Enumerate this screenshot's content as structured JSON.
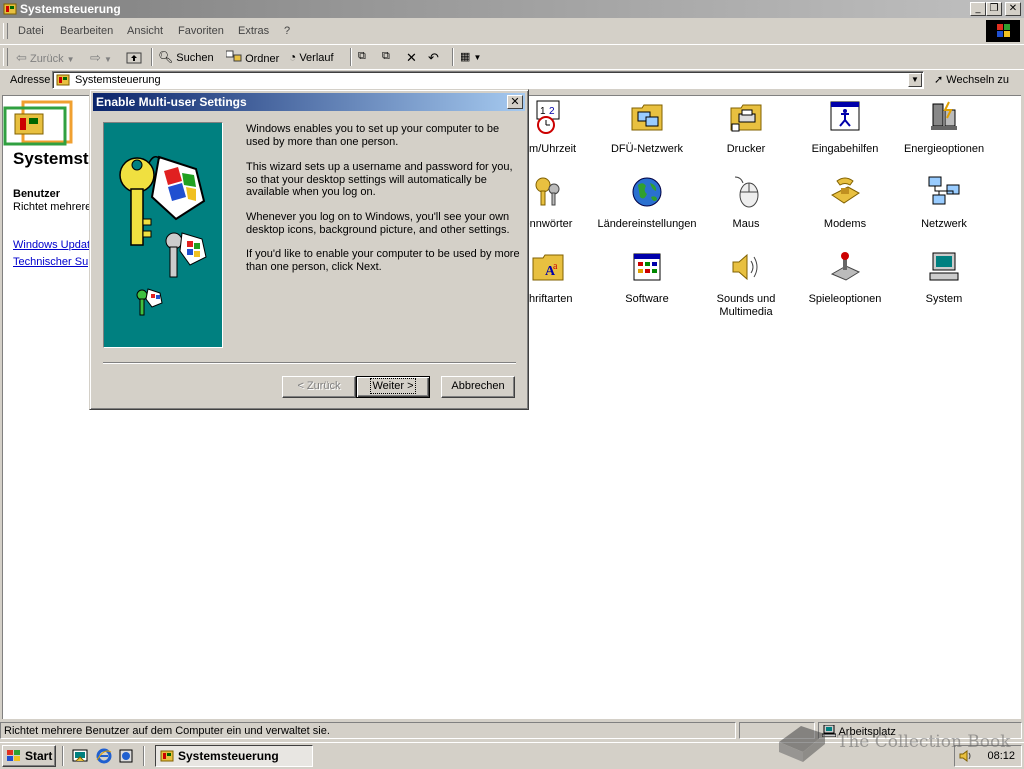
{
  "window": {
    "title": "Systemsteuerung"
  },
  "menu": [
    "Datei",
    "Bearbeiten",
    "Ansicht",
    "Favoriten",
    "Extras",
    "?"
  ],
  "toolbar": {
    "back": "Zurück",
    "search": "Suchen",
    "folders": "Ordner",
    "history": "Verlauf"
  },
  "address": {
    "label": "Adresse",
    "value": "Systemsteuerung",
    "go": "Wechseln zu"
  },
  "left_panel": {
    "title": "Systemst",
    "heading": "Benutzer",
    "text": "Richtet mehrere Computer ein u",
    "links": [
      "Windows Updat",
      "Technischer Sup"
    ]
  },
  "icons": [
    {
      "label": "tum/Uhrzeit",
      "icon": "clock-calendar-icon"
    },
    {
      "label": "DFÜ-Netzwerk",
      "icon": "dialup-network-icon"
    },
    {
      "label": "Drucker",
      "icon": "printer-folder-icon"
    },
    {
      "label": "Eingabehilfen",
      "icon": "accessibility-icon"
    },
    {
      "label": "Energieoptionen",
      "icon": "power-options-icon"
    },
    {
      "label": "ennwörter",
      "icon": "keys-icon"
    },
    {
      "label": "Ländereinstellungen",
      "icon": "globe-icon"
    },
    {
      "label": "Maus",
      "icon": "mouse-icon"
    },
    {
      "label": "Modems",
      "icon": "modem-icon"
    },
    {
      "label": "Netzwerk",
      "icon": "network-icon"
    },
    {
      "label": "chriftarten",
      "icon": "fonts-folder-icon"
    },
    {
      "label": "Software",
      "icon": "software-icon"
    },
    {
      "label": "Sounds und Multimedia",
      "icon": "speaker-icon"
    },
    {
      "label": "Spieleoptionen",
      "icon": "joystick-icon"
    },
    {
      "label": "System",
      "icon": "computer-icon"
    }
  ],
  "dialog": {
    "title": "Enable Multi-user Settings",
    "paragraphs": [
      "Windows enables you to set up your computer to be used by more than one person.",
      "This wizard sets up a username and password for you, so that your desktop settings will automatically be available when you log on.",
      "Whenever you log on to Windows, you'll see your own desktop icons, background picture, and other settings.",
      "If you'd like to enable your computer to be used by more than one person, click Next."
    ],
    "back": "< Zurück",
    "next": "Weiter >",
    "cancel": "Abbrechen"
  },
  "status": {
    "text": "Richtet mehrere Benutzer auf dem Computer ein und verwaltet sie.",
    "zone": "Arbeitsplatz"
  },
  "taskbar": {
    "start": "Start",
    "task": "Systemsteuerung",
    "clock": "08:12"
  },
  "watermark": "The Collection Book"
}
